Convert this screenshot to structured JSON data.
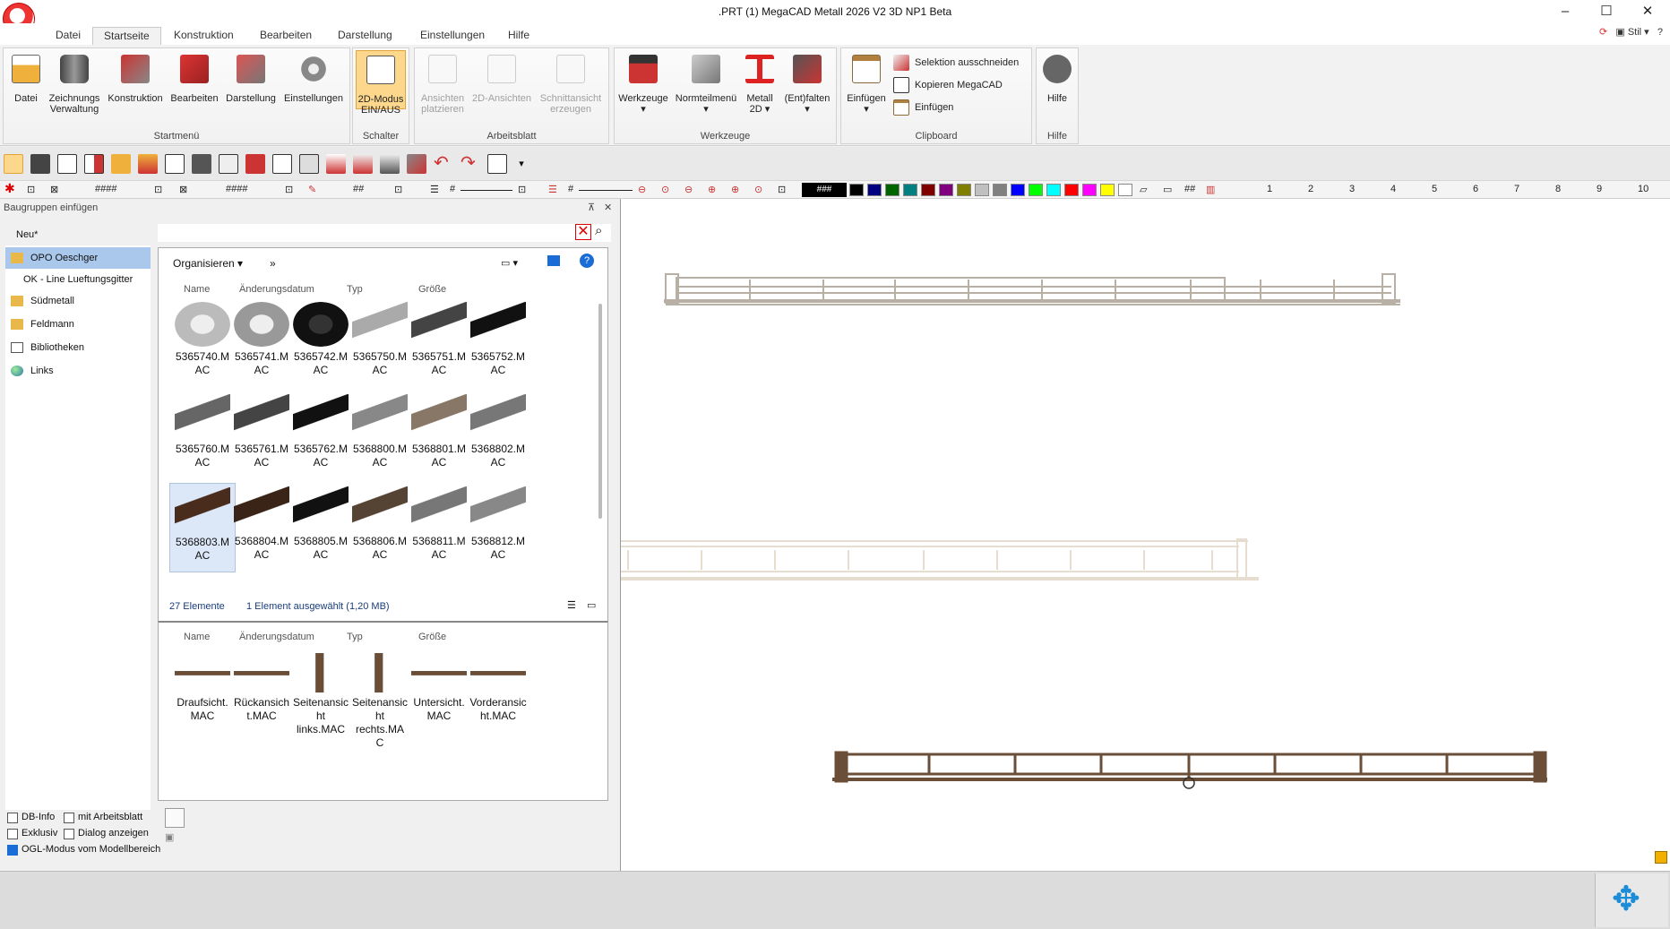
{
  "window": {
    "title": ".PRT (1) MegaCAD Metall 2026 V2 3D NP1 Beta",
    "minimize": "–",
    "maximize": "☐",
    "close": "✕"
  },
  "tabs": [
    "Datei",
    "Startseite",
    "Konstruktion",
    "Bearbeiten",
    "Darstellung",
    "Einstellungen",
    "Hilfe"
  ],
  "right_tools": {
    "stil": "Stil"
  },
  "ribbon": {
    "startmenu": {
      "label": "Startmenü",
      "buttons": [
        "Datei",
        "Zeichnungs\nVerwaltung",
        "Konstruktion",
        "Bearbeiten",
        "Darstellung",
        "Einstellungen"
      ]
    },
    "schalter": {
      "label": "Schalter",
      "button": "2D-Modus\nEIN/AUS"
    },
    "arbeitsblatt": {
      "label": "Arbeitsblatt",
      "buttons": [
        "Ansichten\nplatzieren",
        "2D-Ansichten",
        "Schnittansicht\nerzeugen"
      ]
    },
    "werkzeuge": {
      "label": "Werkzeuge",
      "buttons": [
        "Werkzeuge\n▾",
        "Normteilmenü\n▾",
        "Metall\n2D ▾",
        "(Ent)falten\n▾"
      ]
    },
    "clipboard": {
      "label": "Clipboard",
      "paste": "Einfügen\n▾",
      "cut": "Selektion ausschneiden",
      "copy": "Kopieren MegaCAD",
      "insert": "Einfügen"
    },
    "hilfe": {
      "label": "Hilfe",
      "button": "Hilfe"
    }
  },
  "style_toolbar": {
    "hash1": "####",
    "hash2": "####",
    "hash3": "##",
    "hash4": "#",
    "hash5": "#",
    "color_hash": "###",
    "numbers": [
      "1",
      "2",
      "3",
      "4",
      "5",
      "6",
      "7",
      "8",
      "9",
      "10"
    ]
  },
  "colors": [
    "#000000",
    "#000080",
    "#006400",
    "#008080",
    "#800000",
    "#800080",
    "#808000",
    "#c0c0c0",
    "#808080",
    "#0000ff",
    "#00ff00",
    "#00ffff",
    "#ff0000",
    "#ff00ff",
    "#ffff00",
    "#ffffff"
  ],
  "panel": {
    "title": "Baugruppen einfügen",
    "pin": "⊼",
    "close": "✕"
  },
  "tree": {
    "new_label": "Neu*",
    "items": [
      "OPO Oeschger",
      "OK - Line Lueftungsgitter",
      "Südmetall",
      "Feldmann",
      "Bibliotheken",
      "Links"
    ]
  },
  "explorer": {
    "organize": "Organisieren ▾",
    "more": "»",
    "columns": [
      "Name",
      "Änderungsdatum",
      "Typ",
      "Größe"
    ],
    "files": [
      "5365740.MAC",
      "5365741.MAC",
      "5365742.MAC",
      "5365750.MAC",
      "5365751.MAC",
      "5365752.MAC",
      "5365760.MAC",
      "5365761.MAC",
      "5365762.MAC",
      "5368800.MAC",
      "5368801.MAC",
      "5368802.MAC",
      "5368803.MAC",
      "5368804.MAC",
      "5368805.MAC",
      "5368806.MAC",
      "5368811.MAC",
      "5368812.MAC"
    ],
    "status_count": "27 Elemente",
    "status_selected": "1 Element ausgewählt (1,20 MB)"
  },
  "explorer2": {
    "columns": [
      "Name",
      "Änderungsdatum",
      "Typ",
      "Größe"
    ],
    "files": [
      "Draufsicht.\nMAC",
      "Rückansich\nt.MAC",
      "Seitenansic\nht\nlinks.MAC",
      "Seitenansic\nht\nrechts.MA\nC",
      "Untersicht.\nMAC",
      "Vorderansic\nht.MAC"
    ]
  },
  "options": {
    "db_info": "DB-Info",
    "mit_arbeitsblatt": "mit Arbeitsblatt",
    "exklusiv": "Exklusiv",
    "dialog": "Dialog anzeigen",
    "ogl": "OGL-Modus vom Modellbereich"
  }
}
